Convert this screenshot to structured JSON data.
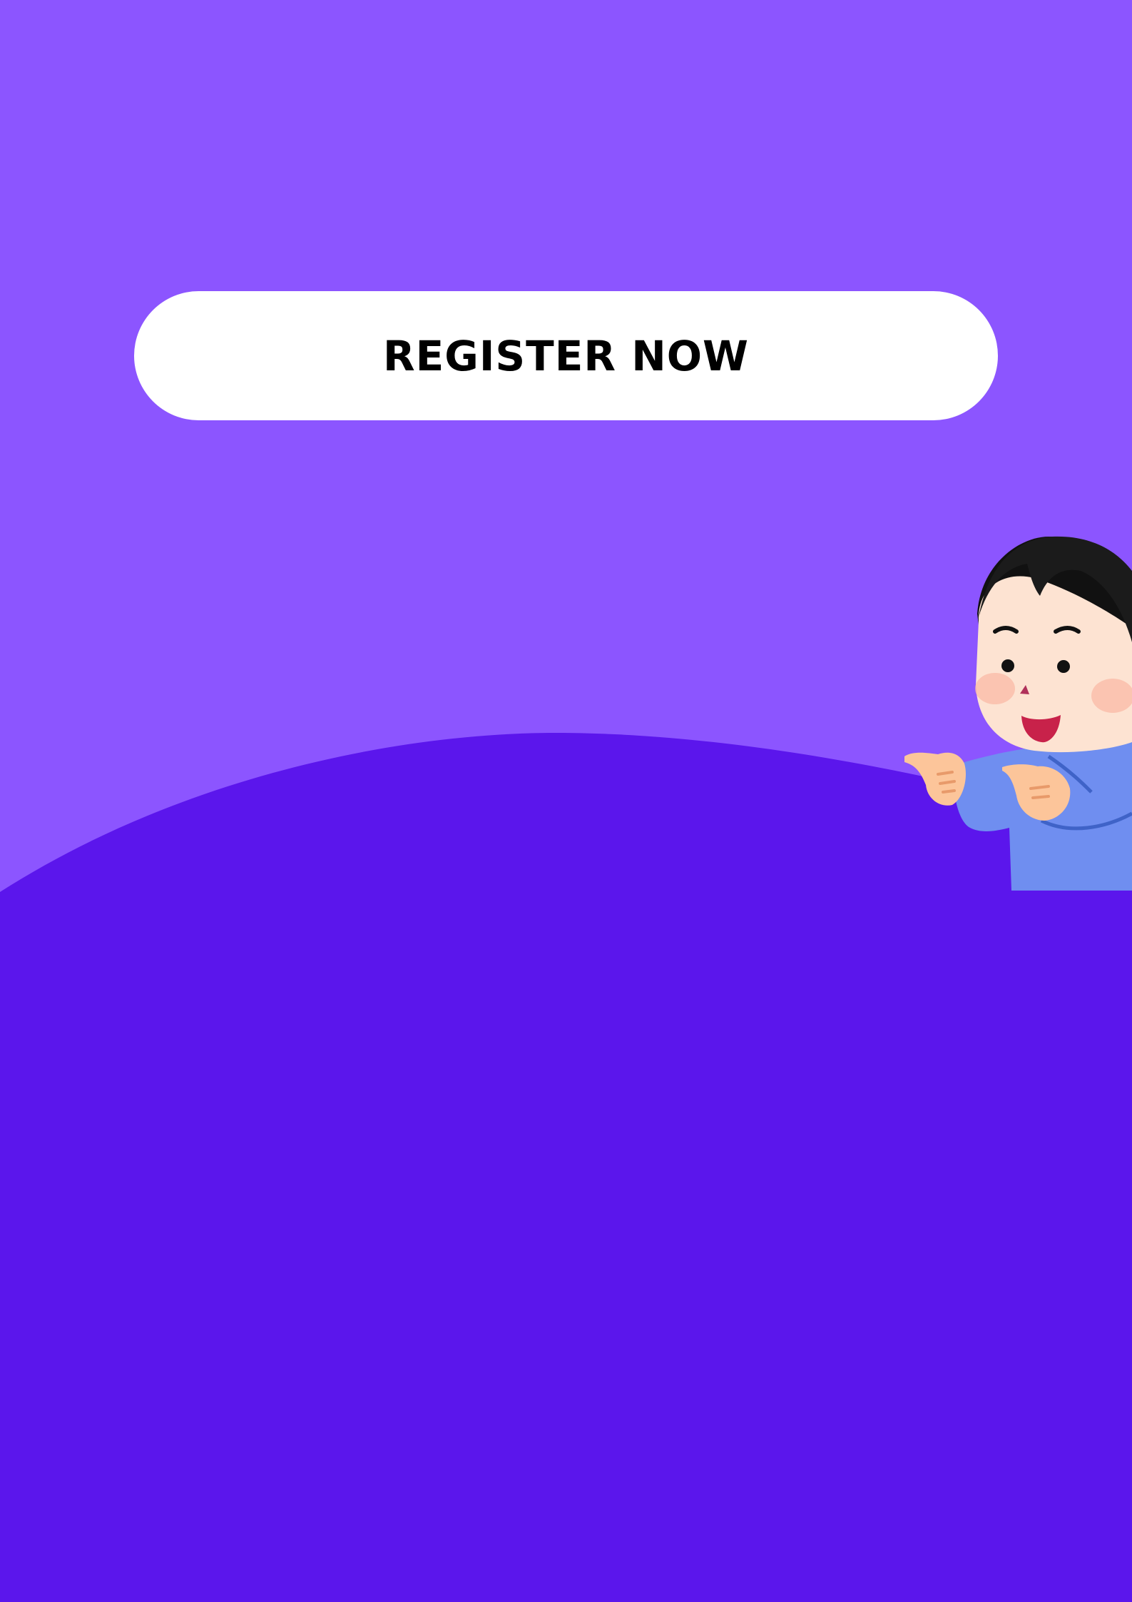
{
  "colors": {
    "background": "#8c55ff",
    "wave": "#5b16ec",
    "button_bg": "#ffffff",
    "button_text": "#000000",
    "mascot_shirt": "#6f8ef0",
    "mascot_skin": "#fde3d2",
    "mascot_hair": "#111111",
    "mascot_mouth": "#c8224a"
  },
  "cta": {
    "label": "REGISTER NOW"
  },
  "illustration": {
    "mascot_icon": "pointing-boy-icon"
  }
}
